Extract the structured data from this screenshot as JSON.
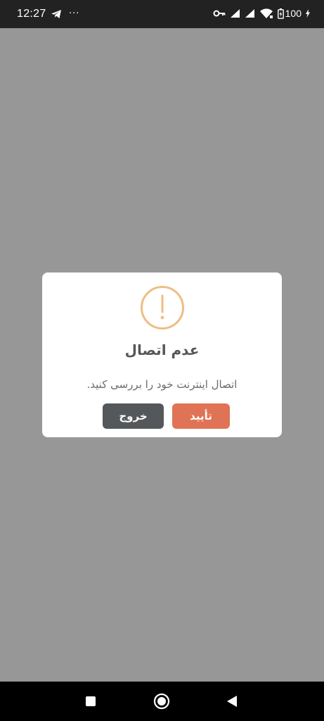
{
  "status_bar": {
    "time": "12:27",
    "more": "···",
    "battery": "100",
    "icons": [
      "telegram-icon",
      "vpn-key-icon",
      "signal-icon",
      "signal-icon",
      "wifi-icon",
      "battery-charging-icon"
    ]
  },
  "dialog": {
    "icon": "exclamation-circle-icon",
    "icon_color": "#eebe84",
    "title": "عدم اتصال",
    "message": "اتصال اینترنت خود را بررسی کنید.",
    "confirm_label": "تأیید",
    "exit_label": "خروج",
    "confirm_color": "#e07355",
    "exit_color": "#55585b"
  },
  "nav_bar": {
    "icons": [
      "recents-square-icon",
      "home-circle-icon",
      "back-triangle-icon"
    ]
  }
}
